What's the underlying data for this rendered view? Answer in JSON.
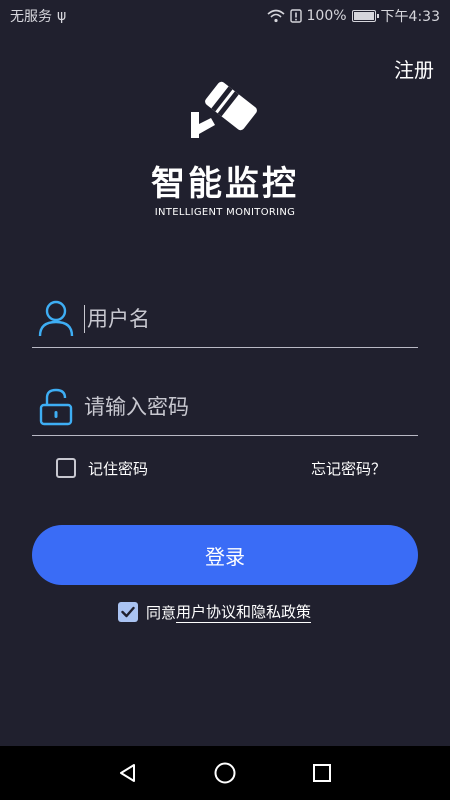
{
  "status_bar": {
    "carrier": "无服务",
    "usb_symbol": "ψ",
    "wifi_icon": "wifi-icon",
    "alert_icon": "alert-icon",
    "battery_percent": "100%",
    "battery_level": 1.0,
    "time": "下午4:33"
  },
  "header": {
    "register_label": "注册"
  },
  "logo": {
    "title": "智能监控",
    "subtitle": "INTELLIGENT MONITORING",
    "icon": "security-camera-icon"
  },
  "form": {
    "username": {
      "value": "",
      "placeholder": "用户名",
      "icon": "user-icon"
    },
    "password": {
      "value": "",
      "placeholder": "请输入密码",
      "icon": "lock-icon"
    },
    "remember_label": "记住密码",
    "remember_checked": false,
    "forgot_label": "忘记密码？",
    "login_label": "登录"
  },
  "agreement": {
    "checked": true,
    "prefix": "同意",
    "link_text": "用户协议和隐私政策"
  },
  "nav_bar": {
    "back_icon": "back-triangle-icon",
    "home_icon": "home-circle-icon",
    "recents_icon": "recents-square-icon"
  },
  "colors": {
    "background": "#20202e",
    "accent": "#3a6cf6",
    "icon_blue": "#3eaef4",
    "checkbox_checked": "#aac3f2"
  }
}
